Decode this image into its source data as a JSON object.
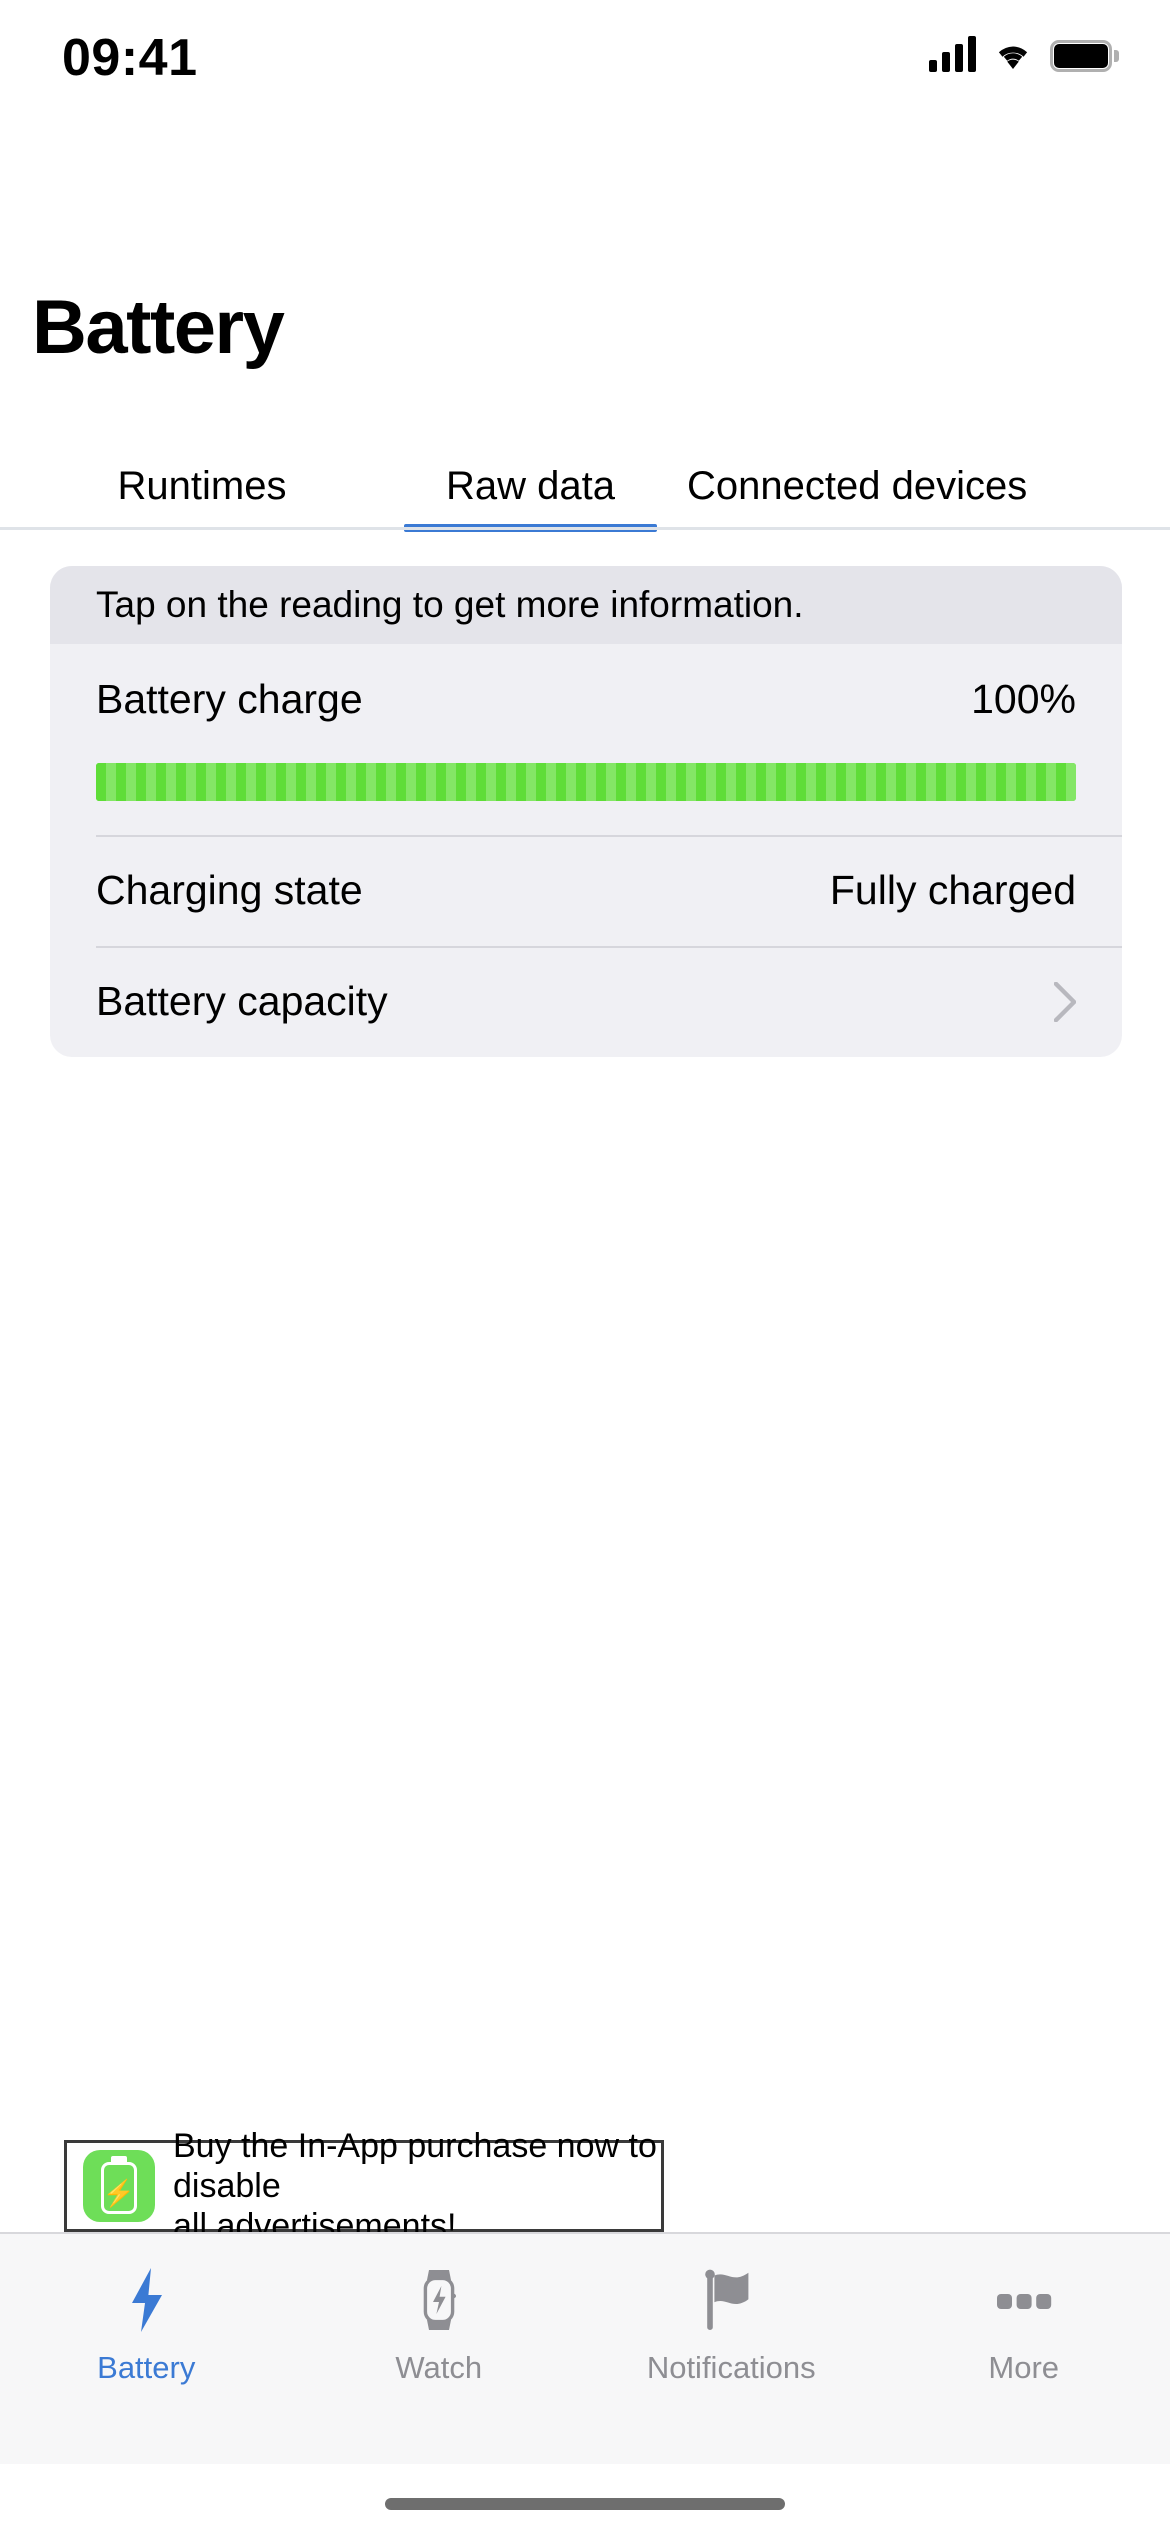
{
  "status_bar": {
    "time": "09:41",
    "cellular_icon": "cellular-signal-icon",
    "wifi_icon": "wifi-icon",
    "battery_icon": "battery-full-icon"
  },
  "header": {
    "title": "Battery"
  },
  "segment_tabs": {
    "items": [
      {
        "label": "Runtimes",
        "selected": false
      },
      {
        "label": "Raw data",
        "selected": true
      },
      {
        "label": "Connected devices",
        "selected": false
      }
    ],
    "indicator_color": "#3b7ad4"
  },
  "card": {
    "hint": "Tap on the reading to get more information.",
    "rows": [
      {
        "label": "Battery charge",
        "value": "100%"
      },
      {
        "label": "Charging state",
        "value": "Fully charged"
      },
      {
        "label": "Battery capacity",
        "value": "",
        "accessory": "chevron-right-icon"
      }
    ],
    "charge_bar": {
      "percent": "100%",
      "color": "#62e03d",
      "stripe_color": "#84e666"
    }
  },
  "advertisement": {
    "icon": "battery-app-icon",
    "text": "Buy the In-App purchase now to disable\nall advertisements!"
  },
  "tab_bar": {
    "items": [
      {
        "label": "Battery",
        "icon": "bolt-icon",
        "active": true
      },
      {
        "label": "Watch",
        "icon": "watch-icon",
        "active": false
      },
      {
        "label": "Notifications",
        "icon": "flag-icon",
        "active": false
      },
      {
        "label": "More",
        "icon": "ellipsis-icon",
        "active": false
      }
    ],
    "active_color": "#3b7ad4",
    "inactive_color": "#8e8e93"
  },
  "home_indicator": "home-indicator"
}
